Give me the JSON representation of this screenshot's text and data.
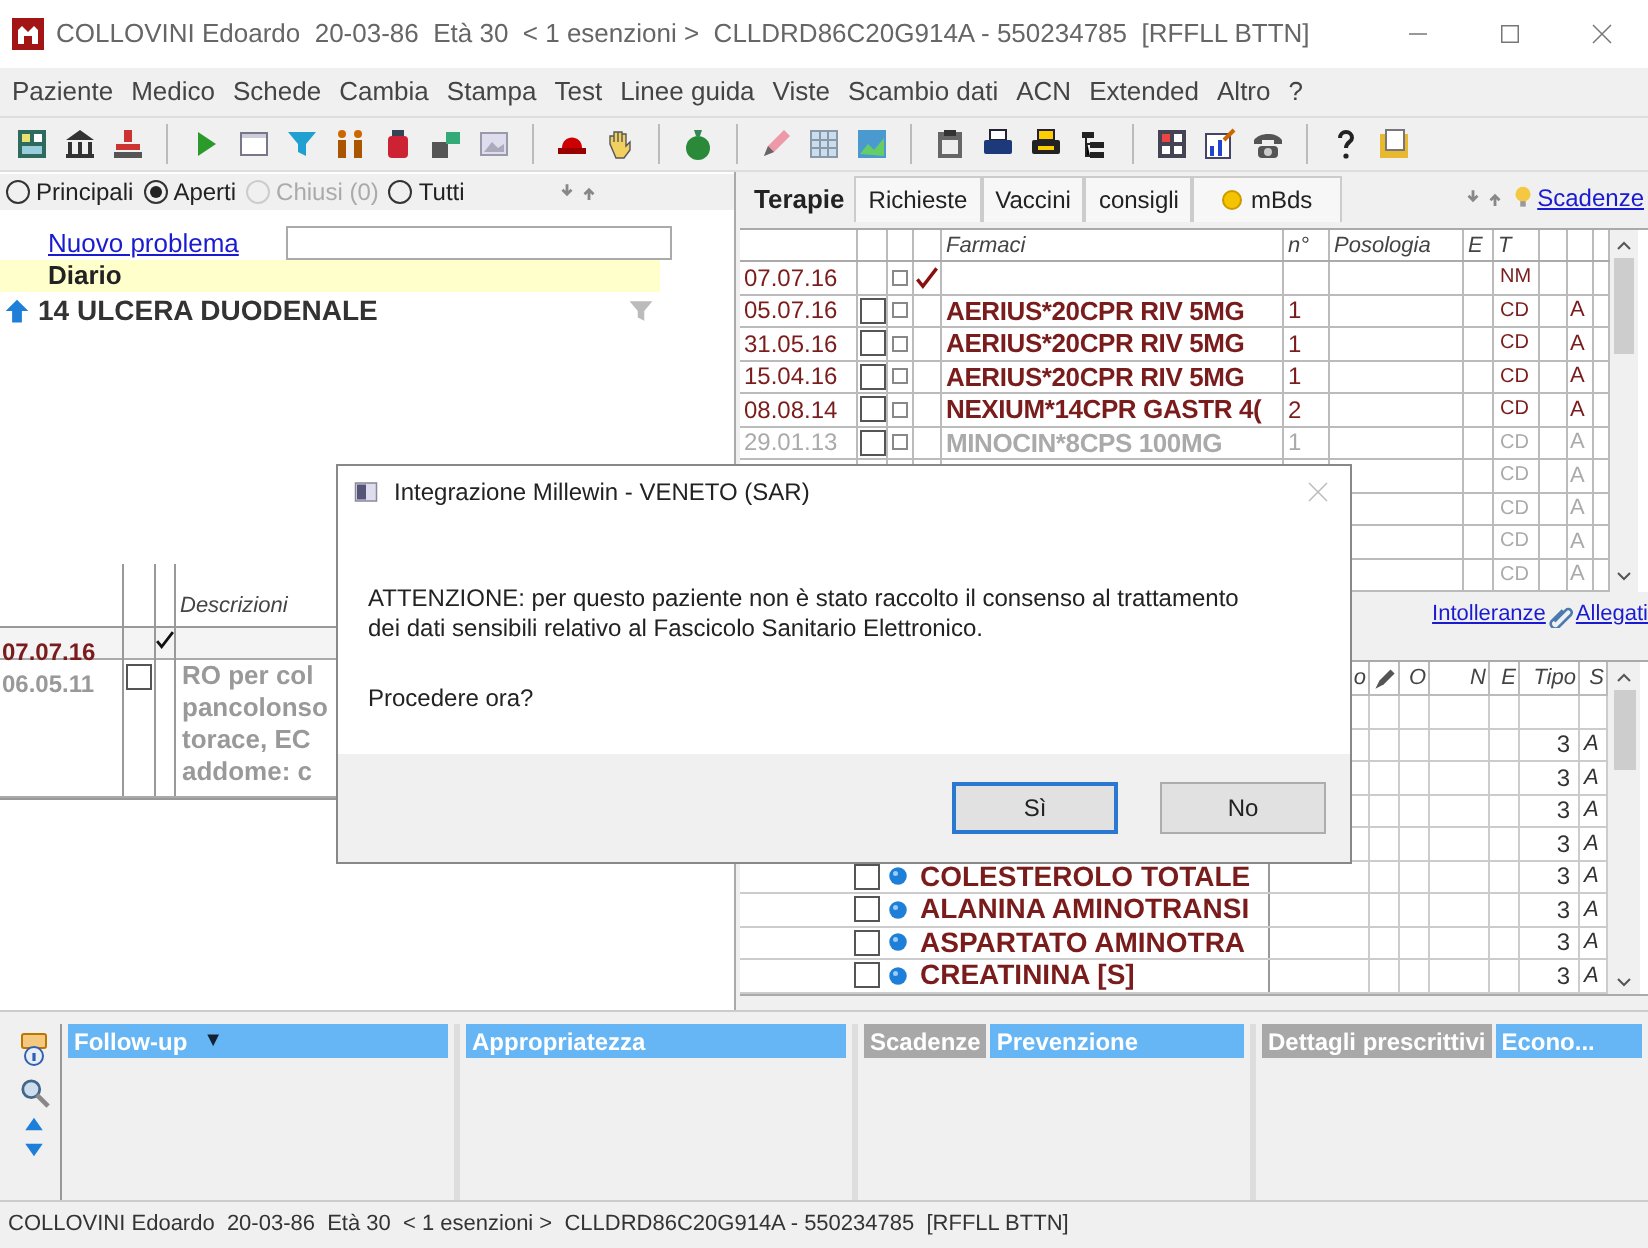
{
  "window": {
    "title": "COLLOVINI Edoardo  20-03-86  Età 30  < 1 esenzioni >  CLLDRD86C20G914A - 550234785  [RFFLL BTTN]"
  },
  "menu": [
    "Paziente",
    "Medico",
    "Schede",
    "Cambia",
    "Stampa",
    "Test",
    "Linee guida",
    "Viste",
    "Scambio dati",
    "ACN",
    "Extended",
    "Altro",
    "?"
  ],
  "problems": {
    "filters": [
      {
        "label": "Principali",
        "selected": false,
        "disabled": false
      },
      {
        "label": "Aperti",
        "selected": true,
        "disabled": false
      },
      {
        "label": "Chiusi (0)",
        "selected": false,
        "disabled": true
      },
      {
        "label": "Tutti",
        "selected": false,
        "disabled": false
      }
    ],
    "new_problem_link": "Nuovo problema",
    "diary": "Diario",
    "items": [
      {
        "label": "14 ULCERA DUODENALE"
      }
    ]
  },
  "diary_table": {
    "columns": [
      "Descrizioni"
    ],
    "rows": [
      {
        "kind": "marker",
        "date": "07.07.16",
        "muted": false
      },
      {
        "kind": "entry",
        "date": "06.05.11",
        "checked": false,
        "muted": true,
        "lines": [
          "RO per col",
          "pancolonso",
          "torace, EC",
          "addome: c"
        ]
      }
    ]
  },
  "therapy": {
    "tabs": [
      {
        "label": "Terapie",
        "selected": true
      },
      {
        "label": "Richieste",
        "selected": false
      },
      {
        "label": "Vaccini",
        "selected": false
      },
      {
        "label": "consigli",
        "selected": false
      },
      {
        "label": "mBds",
        "selected": false,
        "kind": "alert"
      }
    ],
    "deadlines_link": "Scadenze",
    "columns": [
      "Farmaci",
      "n°",
      "Posologia",
      "E",
      "T"
    ],
    "rows": [
      {
        "kind": "marker",
        "date": "07.07.16",
        "small_checked": false,
        "type": "NM",
        "muted": false
      },
      {
        "kind": "drug",
        "date": "05.07.16",
        "checked": false,
        "small_checked": false,
        "drug": "AERIUS*20CPR RIV 5MG",
        "qty": "1",
        "type": "CD",
        "flag": "A",
        "muted": false
      },
      {
        "kind": "drug",
        "date": "31.05.16",
        "checked": false,
        "small_checked": false,
        "drug": "AERIUS*20CPR RIV 5MG",
        "qty": "1",
        "type": "CD",
        "flag": "A",
        "muted": false
      },
      {
        "kind": "drug",
        "date": "15.04.16",
        "checked": false,
        "small_checked": false,
        "drug": "AERIUS*20CPR RIV 5MG",
        "qty": "1",
        "type": "CD",
        "flag": "A",
        "muted": false
      },
      {
        "kind": "drug",
        "date": "08.08.14",
        "checked": false,
        "small_checked": false,
        "drug": "NEXIUM*14CPR GASTR 4(",
        "qty": "2",
        "type": "CD",
        "flag": "A",
        "muted": false
      },
      {
        "kind": "drug",
        "date": "29.01.13",
        "checked": false,
        "small_checked": false,
        "drug": "MINOCIN*8CPS 100MG",
        "qty": "1",
        "type": "CD",
        "flag": "A",
        "muted": true
      },
      {
        "kind": "covered",
        "type": "CD",
        "flag": "A",
        "muted": true
      },
      {
        "kind": "covered",
        "type": "CD",
        "flag": "A",
        "muted": true
      },
      {
        "kind": "covered",
        "type": "CD",
        "flag": "A",
        "muted": true
      },
      {
        "kind": "covered",
        "type": "CD",
        "flag": "A",
        "muted": true
      }
    ]
  },
  "links": {
    "intolerances": "Intolleranze",
    "attachments": "Allegati"
  },
  "exams": {
    "columns": [
      {
        "kind": "text",
        "label": "o"
      },
      {
        "kind": "icon"
      },
      {
        "kind": "text",
        "label": "O"
      },
      {
        "kind": "text",
        "label": "N"
      },
      {
        "kind": "text",
        "label": "E"
      },
      {
        "kind": "text",
        "label": "Tipo"
      },
      {
        "kind": "text",
        "label": "S"
      }
    ],
    "rows": [
      {
        "kind": "blank"
      },
      {
        "kind": "covered",
        "tipo": "3",
        "s": "A"
      },
      {
        "kind": "covered",
        "tipo": "3",
        "s": "A"
      },
      {
        "kind": "covered",
        "tipo": "3",
        "s": "A"
      },
      {
        "kind": "covered",
        "tipo": "3",
        "s": "A"
      },
      {
        "kind": "exam",
        "checked": false,
        "name": "COLESTEROLO TOTALE",
        "tipo": "3",
        "s": "A"
      },
      {
        "kind": "exam",
        "checked": false,
        "name": "ALANINA AMINOTRANSI",
        "tipo": "3",
        "s": "A"
      },
      {
        "kind": "exam",
        "checked": false,
        "name": "ASPARTATO AMINOTRA",
        "tipo": "3",
        "s": "A"
      },
      {
        "kind": "exam",
        "checked": false,
        "name": "CREATININA [S]",
        "tipo": "3",
        "s": "A"
      }
    ]
  },
  "panels": [
    {
      "caret": "▼",
      "tabs": [
        {
          "label": "Follow-up",
          "selected": true
        }
      ]
    },
    {
      "tabs": [
        {
          "label": "Appropriatezza",
          "selected": true
        }
      ]
    },
    {
      "tabs": [
        {
          "label": "Scadenze",
          "selected": false
        },
        {
          "label": "Prevenzione",
          "selected": true
        }
      ]
    },
    {
      "tabs": [
        {
          "label": "Dettagli prescrittivi",
          "selected": false
        },
        {
          "label": "Econo...",
          "selected": true
        }
      ]
    }
  ],
  "status_bar": "COLLOVINI Edoardo  20-03-86  Età 30  < 1 esenzioni >  CLLDRD86C20G914A - 550234785  [RFFLL BTTN]",
  "dialog": {
    "title": "Integrazione Millewin - VENETO (SAR)",
    "message": "ATTENZIONE:  per questo paziente non è stato raccolto il consenso al trattamento dei dati sensibili relativo al Fascicolo Sanitario Elettronico.",
    "question": "Procedere ora?",
    "buttons": [
      {
        "label": "Sì",
        "selected": true
      },
      {
        "label": "No",
        "selected": false
      }
    ]
  }
}
